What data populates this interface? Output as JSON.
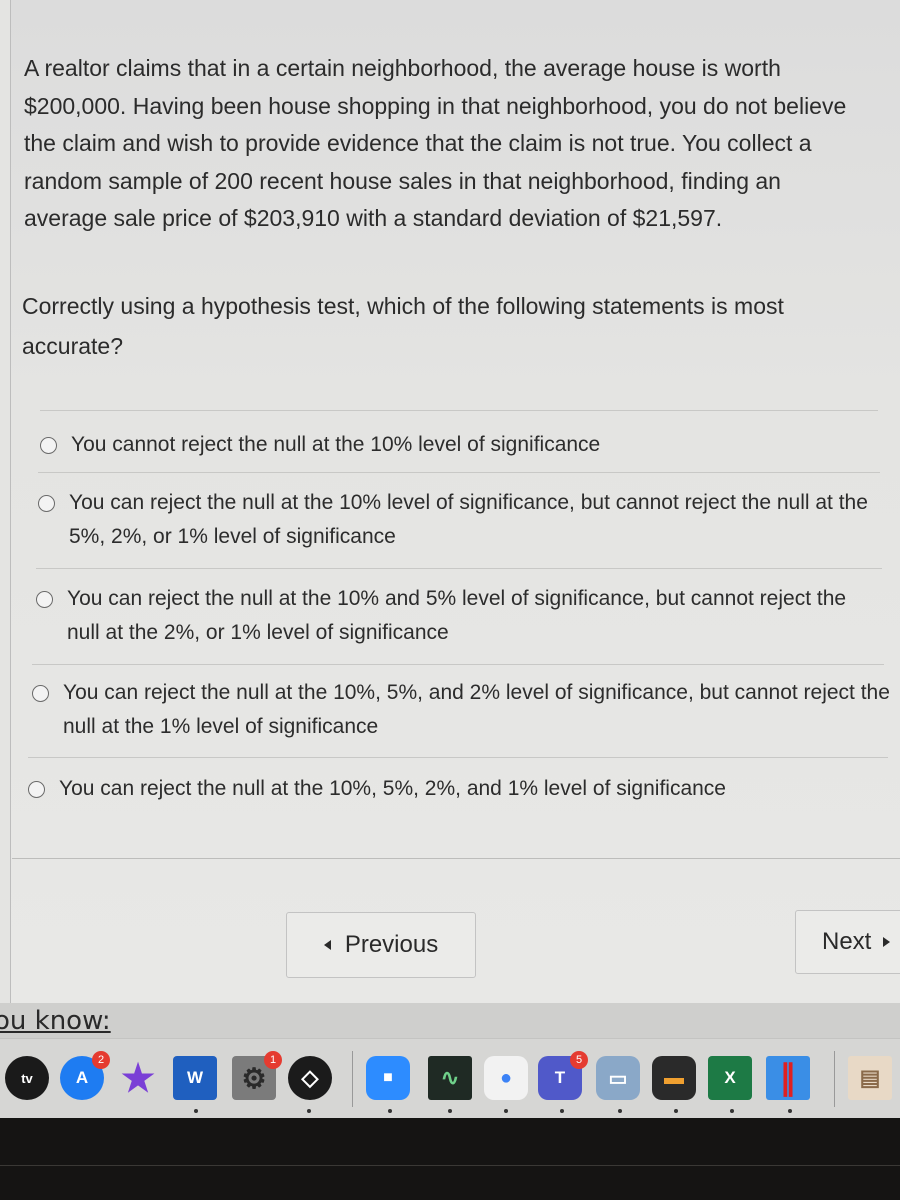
{
  "question": {
    "text": "A realtor claims that in a certain neighborhood, the average house is worth $200,000. Having been house shopping in that neighborhood, you do not believe the claim and wish to provide evidence that the claim is not true. You collect a random sample of 200 recent house sales in that neighborhood, finding an average sale price of $203,910 with a standard deviation of $21,597.",
    "prompt": "Correctly using a hypothesis test, which of the following statements is most accurate?"
  },
  "options": [
    {
      "label": "You cannot reject the null at the 10% level of significance",
      "selected": false
    },
    {
      "label": "You can reject the null at the 10% level of significance, but cannot reject the null at the 5%, 2%, or 1% level of significance",
      "selected": false
    },
    {
      "label": "You can reject the null at the 10% and 5% level of significance, but cannot reject the null at the 2%, or 1% level of significance",
      "selected": false
    },
    {
      "label": "You can reject the null at the 10%, 5%, and 2% level of significance, but cannot reject the null at the 1% level of significance",
      "selected": false
    },
    {
      "label": "You can reject the null at the 10%, 5%, 2%, and 1% level of significance",
      "selected": false
    }
  ],
  "navigation": {
    "previous_label": "Previous",
    "next_label": "Next"
  },
  "footer": {
    "partial_heading": "ou know:"
  },
  "dock": {
    "apps": [
      {
        "name": "Apple TV",
        "glyph": "tv",
        "color": "#1a1a1a",
        "badge": null
      },
      {
        "name": "App Store",
        "glyph": "A",
        "color": "#1e7cf2",
        "badge": "2"
      },
      {
        "name": "iMovie",
        "glyph": "★",
        "color": "#7a3fd6",
        "badge": null
      },
      {
        "name": "Microsoft Word",
        "glyph": "W",
        "color": "#1f5fbf",
        "badge": null
      },
      {
        "name": "System Preferences",
        "glyph": "⚙",
        "color": "#7b7b7b",
        "badge": "1"
      },
      {
        "name": "Shortcuts-style app",
        "glyph": "◇",
        "color": "#1b1b1b",
        "badge": null
      },
      {
        "name": "Zoom",
        "glyph": "■",
        "color": "#2d8cff",
        "badge": null
      },
      {
        "name": "Activity Monitor",
        "glyph": "∿",
        "color": "#1f2a24",
        "badge": null
      },
      {
        "name": "Google Chrome",
        "glyph": "●",
        "color": "#f2f2f2",
        "badge": null
      },
      {
        "name": "Microsoft Teams",
        "glyph": "T",
        "color": "#5059c9",
        "badge": "5"
      },
      {
        "name": "Preview",
        "glyph": "▭",
        "color": "#8aa8c8",
        "badge": null
      },
      {
        "name": "Printer",
        "glyph": "▬",
        "color": "#2a2a2a",
        "badge": null
      },
      {
        "name": "Microsoft Excel",
        "glyph": "X",
        "color": "#1d7a45",
        "badge": null
      },
      {
        "name": "Parallels Desktop",
        "glyph": "∥",
        "color": "#d8e6f4",
        "badge": null
      },
      {
        "name": "Downloads Folder",
        "glyph": "▤",
        "color": "#e8d9c6",
        "badge": null
      }
    ]
  }
}
